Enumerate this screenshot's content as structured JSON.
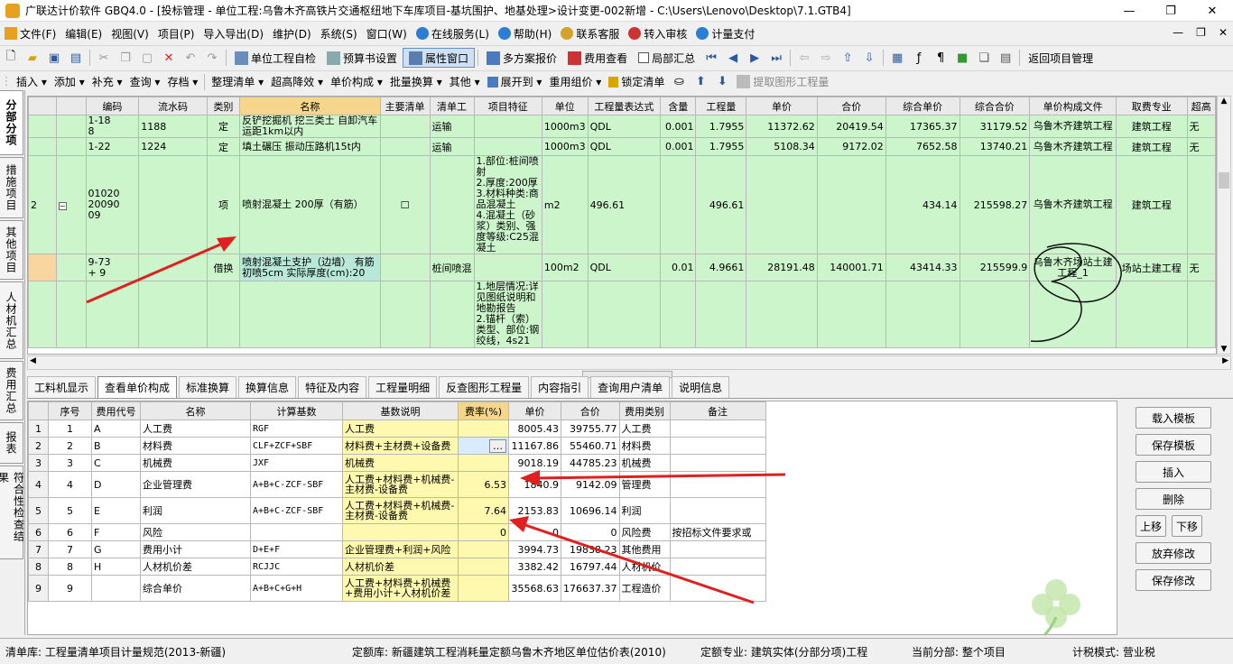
{
  "window": {
    "title": "广联达计价软件 GBQ4.0 - [投标管理 - 单位工程:乌鲁木齐高铁片交通枢纽地下车库项目-基坑围护、地基处理>设计变更-002新增 - C:\\Users\\Lenovo\\Desktop\\7.1.GTB4]",
    "minimize": "—",
    "restore": "❐",
    "close": "✕"
  },
  "menubar": {
    "items": [
      "文件(F)",
      "编辑(E)",
      "视图(V)",
      "项目(P)",
      "导入导出(D)",
      "维护(D)",
      "系统(S)",
      "窗口(W)",
      "在线服务(L)",
      "帮助(H)",
      "联系客服",
      "转入审核",
      "计量支付"
    ],
    "doc_min": "—",
    "doc_restore": "❐",
    "doc_close": "✕"
  },
  "toolbar1": {
    "self_check": "单位工程自检",
    "budget_settings": "预算书设置",
    "property_window": "属性窗口",
    "multi_plan": "多方案报价",
    "fee_view": "费用查看",
    "local_summary": "局部汇总",
    "return_project": "返回项目管理"
  },
  "toolbar2": {
    "insert": "插入",
    "add": "添加",
    "supplement": "补充",
    "query": "查询",
    "store": "存档",
    "organize": "整理清单",
    "super_reduce": "超高降效",
    "unit_price_comp": "单价构成",
    "batch_convert": "批量换算",
    "other": "其他",
    "expand_to": "展开到",
    "reuse_group": "重用组价",
    "lock_list": "锁定清单",
    "extract_qty": "提取图形工程量"
  },
  "sidetabs": [
    "分部分项",
    "措施项目",
    "其他项目",
    "人材机汇总",
    "费用汇总",
    "报表",
    "符合性检查结果"
  ],
  "upper_table": {
    "headers": [
      "",
      "",
      "编码",
      "流水码",
      "类别",
      "名称",
      "主要清单",
      "清单工",
      "项目特征",
      "单位",
      "工程量表达式",
      "含量",
      "工程量",
      "单价",
      "合价",
      "综合单价",
      "综合合价",
      "单价构成文件",
      "取费专业",
      "超高"
    ],
    "rows": [
      {
        "no": "",
        "code": "1-18\n8",
        "serial": "1188",
        "type": "定",
        "name": "反铲挖掘机 挖三类土 自卸汽车运距1km以内",
        "main": "",
        "work": "运输",
        "feature": "",
        "unit": "1000m3",
        "expr": "QDL",
        "content": "0.001",
        "qty": "1.7955",
        "price": "11372.62",
        "total": "20419.54",
        "comp_price": "17365.37",
        "comp_total": "31179.52",
        "file": "乌鲁木齐建筑工程",
        "spec": "建筑工程",
        "super": "无"
      },
      {
        "no": "",
        "code": "1-22",
        "serial": "1224",
        "type": "定",
        "name": "填土碾压 振动压路机15t内",
        "main": "",
        "work": "运输",
        "feature": "",
        "unit": "1000m3",
        "expr": "QDL",
        "content": "0.001",
        "qty": "1.7955",
        "price": "5108.34",
        "total": "9172.02",
        "comp_price": "7652.58",
        "comp_total": "13740.21",
        "file": "乌鲁木齐建筑工程",
        "spec": "建筑工程",
        "super": "无"
      },
      {
        "no": "2",
        "code": "01020\n20090\n09",
        "serial": "",
        "type": "项",
        "name": "喷射混凝土 200厚（有筋）",
        "main": "☐",
        "work": "",
        "feature": "1.部位:桩间喷射\n2.厚度:200厚\n3.材料种类:商品混凝土\n4.混凝土（砂浆）类别、强度等级:C25混凝土",
        "unit": "m2",
        "expr": "496.61",
        "content": "",
        "qty": "496.61",
        "price": "",
        "total": "",
        "comp_price": "434.14",
        "comp_total": "215598.27",
        "file": "乌鲁木齐建筑工程",
        "spec": "建筑工程",
        "super": ""
      },
      {
        "no": "",
        "code": "9-73\n+ 9",
        "serial": "",
        "type": "借换",
        "name": "喷射混凝土支护（边墙） 有筋 初喷5cm 实际厚度(cm):20",
        "main": "",
        "work": "桩间喷混",
        "feature": "",
        "unit": "100m2",
        "expr": "QDL",
        "content": "0.01",
        "qty": "4.9661",
        "price": "28191.48",
        "total": "140001.71",
        "comp_price": "43414.33",
        "comp_total": "215599.9",
        "file": "乌鲁木齐场站土建工程_1",
        "spec": "场站土建工程",
        "super": "无"
      },
      {
        "no": "",
        "code": "",
        "serial": "",
        "type": "",
        "name": "",
        "main": "",
        "work": "",
        "feature": "1.地层情况:详见图纸说明和地勘报告\n2.锚杆（索）类型、部位:钢绞线，4s21",
        "unit": "",
        "expr": "",
        "content": "",
        "qty": "",
        "price": "",
        "total": "",
        "comp_price": "",
        "comp_total": "",
        "file": "",
        "spec": "",
        "super": ""
      }
    ]
  },
  "bottom_tabs": [
    "工料机显示",
    "查看单价构成",
    "标准换算",
    "换算信息",
    "特征及内容",
    "工程量明细",
    "反查图形工程量",
    "内容指引",
    "查询用户清单",
    "说明信息"
  ],
  "lower_table": {
    "headers": [
      "",
      "序号",
      "费用代号",
      "名称",
      "计算基数",
      "基数说明",
      "费率(%)",
      "单价",
      "合价",
      "费用类别",
      "备注"
    ],
    "rows": [
      {
        "r": "1",
        "seq": "1",
        "code": "A",
        "name": "人工费",
        "base": "RGF",
        "desc": "人工费",
        "rate": "",
        "price": "8005.43",
        "total": "39755.77",
        "cat": "人工费",
        "note": ""
      },
      {
        "r": "2",
        "seq": "2",
        "code": "B",
        "name": "材料费",
        "base": "CLF+ZCF+SBF",
        "desc": "材料费+主材费+设备费",
        "rate": "…",
        "price": "11167.86",
        "total": "55460.71",
        "cat": "材料费",
        "note": ""
      },
      {
        "r": "3",
        "seq": "3",
        "code": "C",
        "name": "机械费",
        "base": "JXF",
        "desc": "机械费",
        "rate": "",
        "price": "9018.19",
        "total": "44785.23",
        "cat": "机械费",
        "note": ""
      },
      {
        "r": "4",
        "seq": "4",
        "code": "D",
        "name": "企业管理费",
        "base": "A+B+C-ZCF-SBF",
        "desc": "人工费+材料费+机械费-主材费-设备费",
        "rate": "6.53",
        "price": "1840.9",
        "total": "9142.09",
        "cat": "管理费",
        "note": ""
      },
      {
        "r": "5",
        "seq": "5",
        "code": "E",
        "name": "利润",
        "base": "A+B+C-ZCF-SBF",
        "desc": "人工费+材料费+机械费-主材费-设备费",
        "rate": "7.64",
        "price": "2153.83",
        "total": "10696.14",
        "cat": "利润",
        "note": ""
      },
      {
        "r": "6",
        "seq": "6",
        "code": "F",
        "name": "风险",
        "base": "",
        "desc": "",
        "rate": "0",
        "price": "0",
        "total": "0",
        "cat": "风险费",
        "note": "按招标文件要求或"
      },
      {
        "r": "7",
        "seq": "7",
        "code": "G",
        "name": "费用小计",
        "base": "D+E+F",
        "desc": "企业管理费+利润+风险",
        "rate": "",
        "price": "3994.73",
        "total": "19838.23",
        "cat": "其他费用",
        "note": ""
      },
      {
        "r": "8",
        "seq": "8",
        "code": "H",
        "name": "人材机价差",
        "base": "RCJJC",
        "desc": "人材机价差",
        "rate": "",
        "price": "3382.42",
        "total": "16797.44",
        "cat": "人材机价",
        "note": ""
      },
      {
        "r": "9",
        "seq": "9",
        "code": "",
        "name": "综合单价",
        "base": "A+B+C+G+H",
        "desc": "人工费+材料费+机械费+费用小计+人材机价差",
        "rate": "",
        "price": "35568.63",
        "total": "176637.37",
        "cat": "工程造价",
        "note": ""
      }
    ]
  },
  "right_buttons": {
    "load_template": "载入模板",
    "save_template": "保存模板",
    "insert": "插入",
    "delete": "删除",
    "move_up": "上移",
    "move_down": "下移",
    "discard": "放弃修改",
    "save_changes": "保存修改"
  },
  "statusbar": {
    "list_lib": "清单库: 工程量清单项目计量规范(2013-新疆)",
    "quota_lib": "定额库: 新疆建筑工程消耗量定额乌鲁木齐地区单位估价表(2010)",
    "quota_spec": "定额专业: 建筑实体(分部分项)工程",
    "current_div": "当前分部: 整个项目",
    "tax_mode": "计税模式: 营业税"
  },
  "colors": {
    "row_green": "#ccf5cc",
    "yellow_cell": "#fff9b0",
    "name_header": "#f5d68a",
    "arrow_red": "#e02020"
  }
}
